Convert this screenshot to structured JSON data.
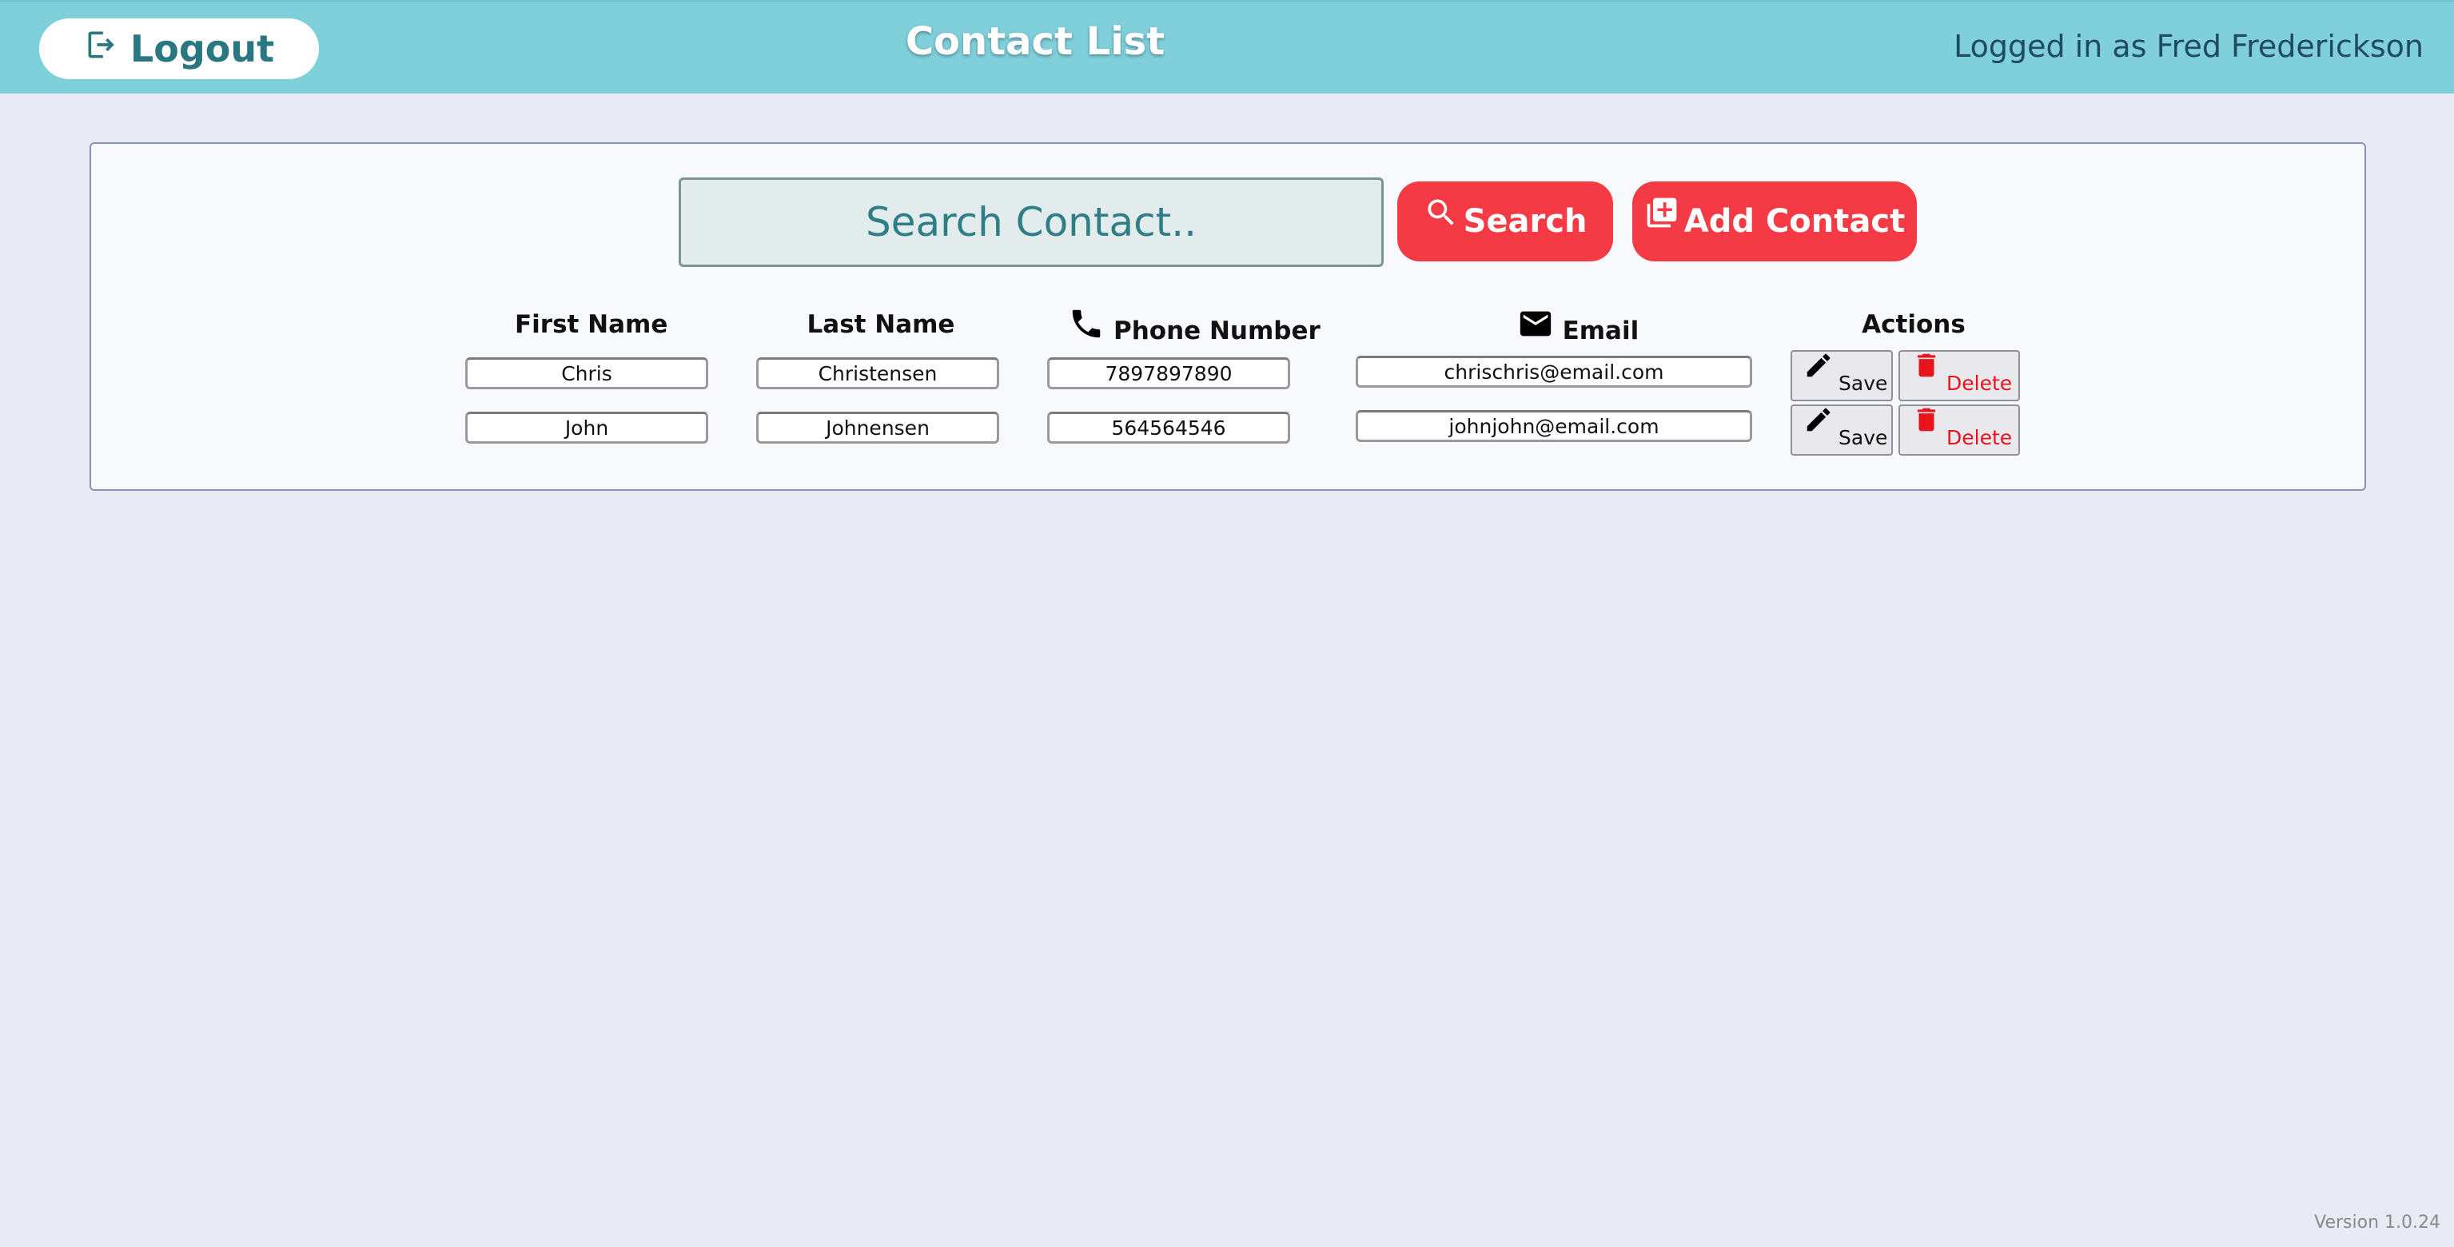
{
  "header": {
    "logout_label": "Logout",
    "title": "Contact List",
    "logged_in_text": "Logged in as Fred Frederickson"
  },
  "search": {
    "placeholder": "Search Contact..",
    "value": "",
    "search_label": "Search",
    "add_label": "Add Contact"
  },
  "table": {
    "headers": {
      "first_name": "First Name",
      "last_name": "Last Name",
      "phone": "Phone Number",
      "email": "Email",
      "actions": "Actions"
    },
    "rows": [
      {
        "first_name": "Chris",
        "last_name": "Christensen",
        "phone": "7897897890",
        "email": "chrischris@email.com",
        "save_label": "Save",
        "delete_label": "Delete"
      },
      {
        "first_name": "John",
        "last_name": "Johnensen",
        "phone": "564564546",
        "email": "johnjohn@email.com",
        "save_label": "Save",
        "delete_label": "Delete"
      }
    ]
  },
  "footer": {
    "version": "Version 1.0.24"
  },
  "icons": {
    "logout": "logout-icon",
    "search": "search-icon",
    "add": "add-box-icon",
    "phone": "phone-icon",
    "email": "mail-icon",
    "edit": "pencil-icon",
    "delete": "trash-icon"
  },
  "colors": {
    "header_bg": "#80d0dc",
    "accent_red": "#f43a45",
    "page_bg": "#e8ebf3",
    "title_teal": "#2a7681"
  }
}
